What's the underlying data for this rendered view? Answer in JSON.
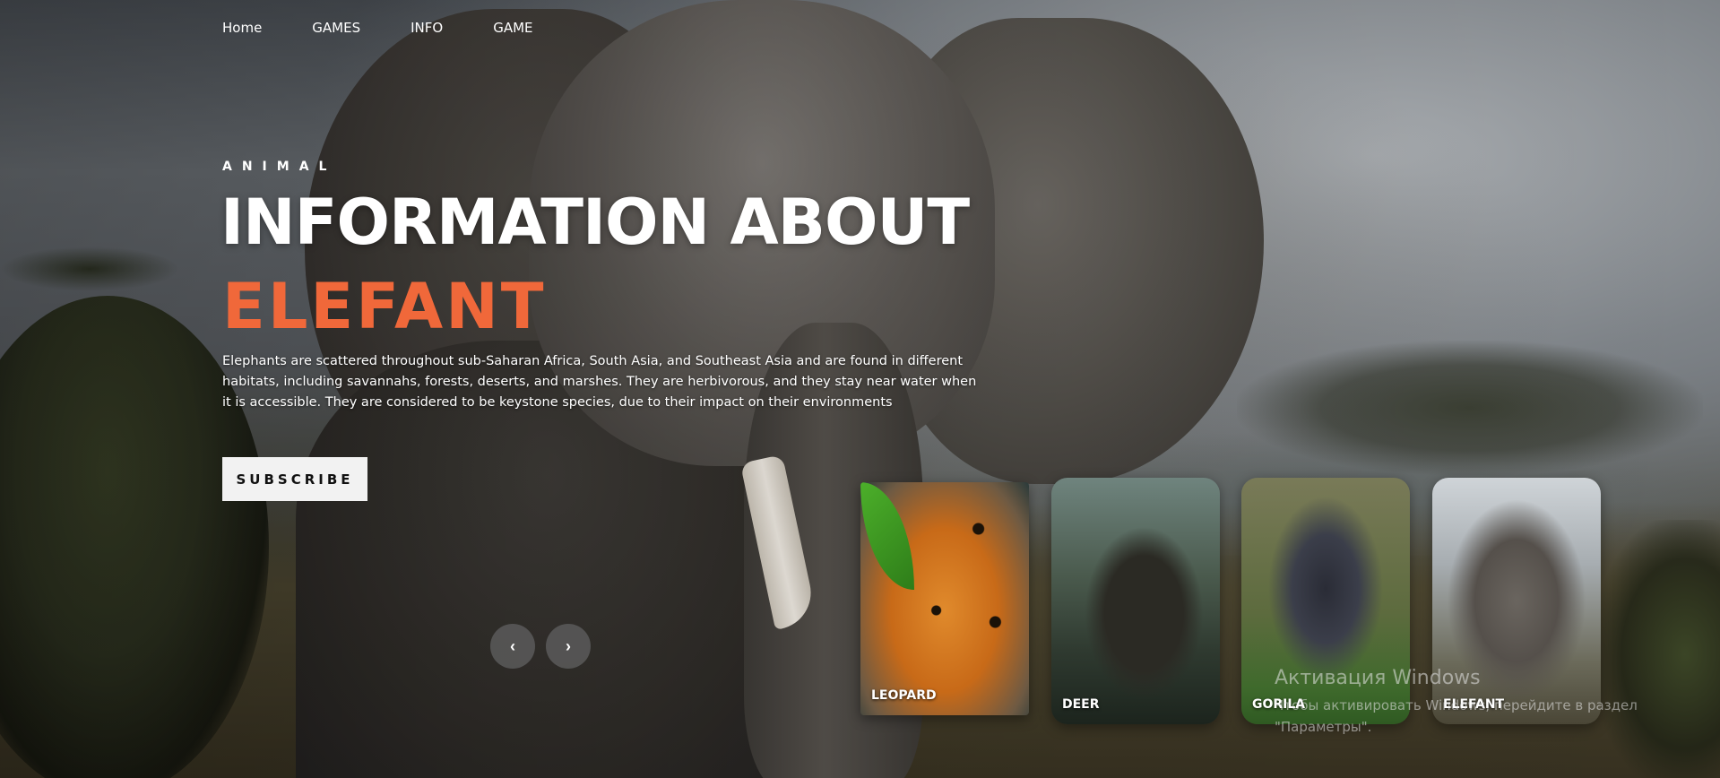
{
  "nav": {
    "items": [
      {
        "label": "Home"
      },
      {
        "label": "GAMES"
      },
      {
        "label": "INFO"
      },
      {
        "label": "GAME"
      }
    ]
  },
  "hero": {
    "eyebrow": "ANIMAL",
    "title": "INFORMATION ABOUT",
    "subtitle": "ELEFANT",
    "description": "Elephants are scattered throughout sub-Saharan Africa, South Asia, and Southeast Asia and are found in different habitats, including savannahs, forests, deserts, and marshes. They are herbivorous, and they stay near water when it is accessible. They are considered to be keystone species, due to their impact on their environments",
    "subscribe_label": "SUBSCRIBE"
  },
  "slider": {
    "prev_icon": "chevron-left-icon",
    "next_icon": "chevron-right-icon",
    "prev_glyph": "‹",
    "next_glyph": "›"
  },
  "cards": [
    {
      "label": "LEOPARD"
    },
    {
      "label": "DEER"
    },
    {
      "label": "GORILA"
    },
    {
      "label": "ELEFANT"
    }
  ],
  "watermark": {
    "title": "Активация Windows",
    "line1": "Чтобы активировать Windows, перейдите в раздел",
    "line2": "\"Параметры\"."
  },
  "colors": {
    "accent": "#f0683a",
    "button_bg": "#f2f2f2"
  }
}
